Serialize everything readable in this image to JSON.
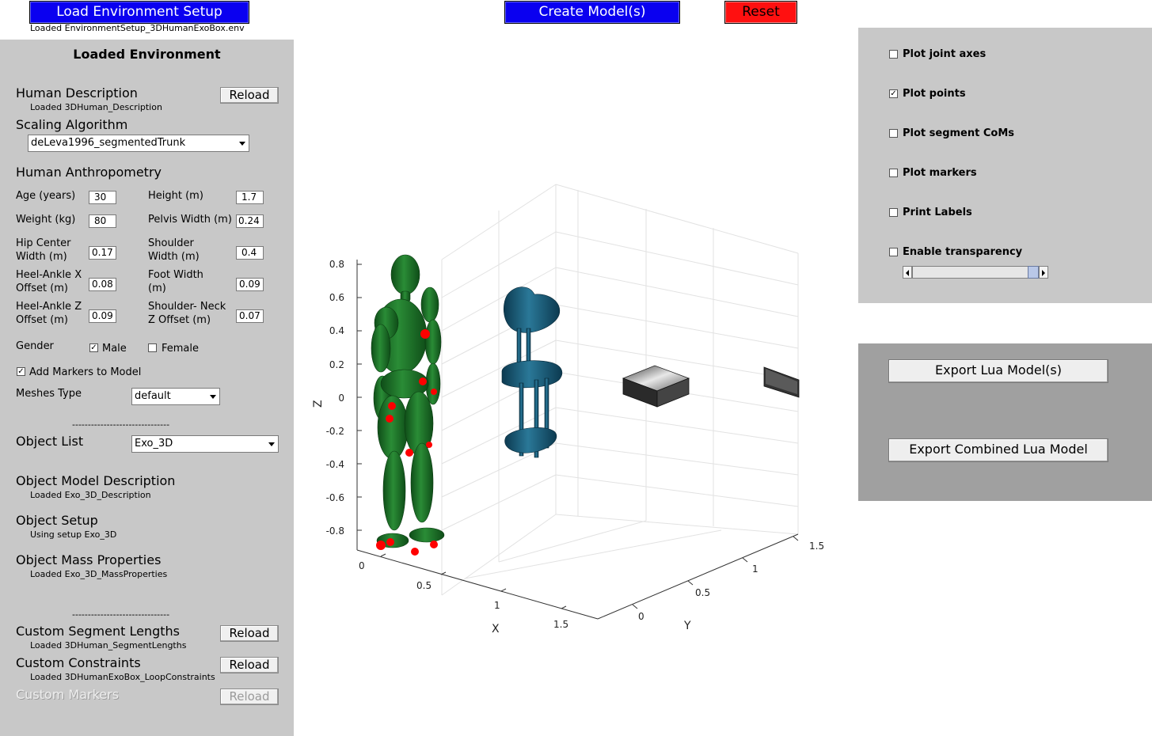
{
  "topbar": {
    "load_env_label": "Load Environment Setup",
    "loaded_env_file": "Loaded EnvironmentSetup_3DHumanExoBox.env",
    "create_models_label": "Create Model(s)",
    "reset_label": "Reset"
  },
  "left_panel": {
    "title": "Loaded Environment",
    "human_description": {
      "label": "Human Description",
      "status": "Loaded 3DHuman_Description",
      "reload": "Reload"
    },
    "scaling": {
      "label": "Scaling Algorithm",
      "selected": "deLeva1996_segmentedTrunk"
    },
    "anthropometry": {
      "label": "Human Anthropometry",
      "age_label": "Age (years)",
      "age_value": "30",
      "height_label": "Height (m)",
      "height_value": "1.7",
      "weight_label": "Weight (kg)",
      "weight_value": "80",
      "pelvis_label": "Pelvis Width (m)",
      "pelvis_value": "0.24",
      "hip_label_1": "Hip Center",
      "hip_label_2": "Width (m)",
      "hip_value": "0.17",
      "shoulder_label_1": "Shoulder",
      "shoulder_label_2": "Width (m)",
      "shoulder_value": "0.4",
      "heelx_label_1": "Heel-Ankle X",
      "heelx_label_2": "Offset (m)",
      "heelx_value": "0.08",
      "foot_label_1": "Foot Width",
      "foot_label_2": "(m)",
      "foot_value": "0.09",
      "heelz_label_1": "Heel-Ankle Z",
      "heelz_label_2": "Offset (m)",
      "heelz_value": "0.09",
      "shneck_label_1": "Shoulder- Neck",
      "shneck_label_2": "Z Offset (m)",
      "shneck_value": "0.07"
    },
    "gender": {
      "label": "Gender",
      "male": "Male",
      "female": "Female",
      "male_checked": true,
      "female_checked": false
    },
    "add_markers": {
      "label": "Add Markers to Model",
      "checked": true
    },
    "meshes": {
      "label": "Meshes Type",
      "selected": "default"
    },
    "separator": "-------------------------------",
    "object_list": {
      "label": "Object List",
      "selected": "Exo_3D"
    },
    "object_model": {
      "label": "Object Model Description",
      "status": "Loaded Exo_3D_Description"
    },
    "object_setup": {
      "label": "Object Setup",
      "status": "Using setup Exo_3D"
    },
    "object_mass": {
      "label": "Object Mass Properties",
      "status": "Loaded Exo_3D_MassProperties"
    },
    "custom_segments": {
      "label": "Custom Segment Lengths",
      "status": "Loaded 3DHuman_SegmentLengths",
      "reload": "Reload"
    },
    "custom_constraints": {
      "label": "Custom Constraints",
      "status": "Loaded 3DHumanExoBox_LoopConstraints",
      "reload": "Reload"
    },
    "custom_markers": {
      "label": "Custom Markers",
      "reload": "Reload"
    }
  },
  "plot_options": {
    "joint_axes": {
      "label": "Plot joint axes",
      "checked": false
    },
    "points": {
      "label": "Plot points",
      "checked": true
    },
    "segment_coms": {
      "label": "Plot segment CoMs",
      "checked": false
    },
    "markers": {
      "label": "Plot markers",
      "checked": false
    },
    "labels": {
      "label": "Print Labels",
      "checked": false
    },
    "transparency": {
      "label": "Enable transparency",
      "checked": false,
      "slider_value": 1.0
    }
  },
  "export": {
    "lua_models": "Export Lua Model(s)",
    "combined": "Export Combined Lua Model"
  },
  "axes3d": {
    "z_label": "Z",
    "x_label": "X",
    "y_label": "Y",
    "z_ticks": [
      "0.8",
      "0.6",
      "0.4",
      "0.2",
      "0",
      "-0.2",
      "-0.4",
      "-0.6",
      "-0.8"
    ],
    "x_ticks": [
      "0",
      "0.5",
      "1",
      "1.5"
    ],
    "y_ticks": [
      "0",
      "0.5",
      "1",
      "1.5"
    ]
  },
  "colors": {
    "human": "#1e7a2a",
    "exo": "#1a5a78",
    "marker": "#ff0000"
  }
}
